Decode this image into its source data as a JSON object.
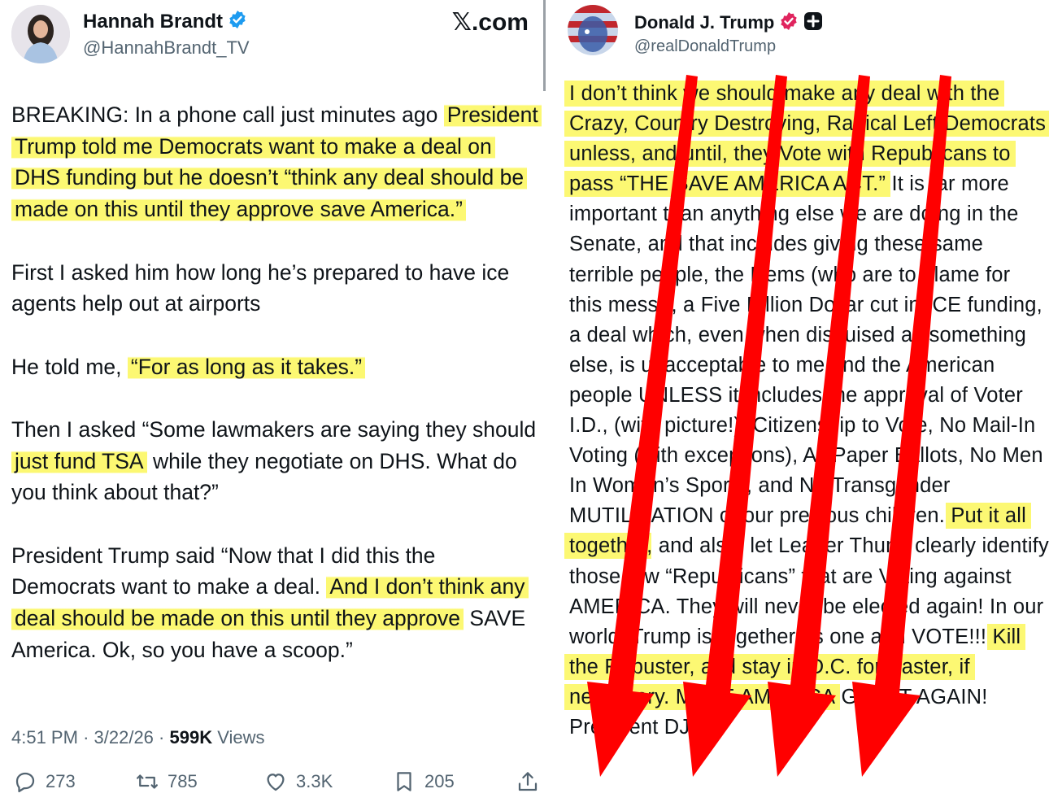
{
  "left_tweet": {
    "author": {
      "name": "Hannah Brandt",
      "handle": "@HannahBrandt_TV"
    },
    "site_mark": "𝕏.com",
    "paragraphs": [
      [
        "BREAKING: In a phone call just minutes ago ",
        "President Trump told me Democrats want to make a deal on DHS funding but he doesn’t “think any deal should be made on this until they approve save America.”"
      ],
      [
        "First I asked him how long he’s prepared to have ice agents help out at airports"
      ],
      [
        "He told me, ",
        "“For as long as it takes.”"
      ],
      [
        "Then I asked “Some lawmakers are saying they should ",
        "just fund TSA",
        " while they negotiate on DHS. What do you think about that?”"
      ],
      [
        "President Trump said “Now that I did this the Democrats want to make a deal. ",
        "And I don’t think any deal should be made on this until they approve",
        " SAVE America. Ok, so you have a scoop.”"
      ]
    ],
    "meta": {
      "time": "4:51 PM",
      "sep": "·",
      "date": "3/22/26",
      "views_count": "599K",
      "views_label": "Views"
    },
    "actions": {
      "replies": "273",
      "reposts": "785",
      "likes": "3.3K",
      "bookmarks": "205"
    },
    "colors": {
      "highlight": "#fbf75a",
      "verified": "#1d9bf0"
    }
  },
  "right_tweet": {
    "author": {
      "name": "Donald J. Trump",
      "handle": "@realDonaldTrump"
    },
    "text_highlight_1": "I don’t think we should make any deal with the Crazy, Country Destroying, Radical Left Democrats unless, and until, they Vote with Republicans to pass “THE SAVE AMERICA ACT.”",
    "text_plain_1": " It is far more important than anything else we are doing in the Senate, and that includes giving these same terrible people, the Dems (who are to blame for this mess!), a Five Billion Dollar cut in ICE funding, a deal which, even when disguised as something else, is unacceptable to me and the American people UNLESS it includes the approval of Voter I.D., (with picture!), Citizenship to Vote, No Mail-In Voting (with exceptions), All Paper Ballots, No Men In Women’s Sports, and No Transgender MUTILIZATION of our precious children. ",
    "text_highlight_2": "Put it all together",
    "text_plain_2": ", and also, let Leader Thune clearly identify those few “Republicans” that are Voting against AMERICA. They will never be elected again! In our world, Trump is ",
    "text_plain_3": "together as one and VOTE!!! ",
    "text_highlight_3": "Kill the Filibuster, and stay in D.C. for Easter, if necessary. MAKE AMERICA",
    "text_plain_4": " GREAT AGAIN! President DJT",
    "colors": {
      "arrow": "#ff0000",
      "highlight": "#fbf75a",
      "verified": "#e0245e"
    }
  }
}
